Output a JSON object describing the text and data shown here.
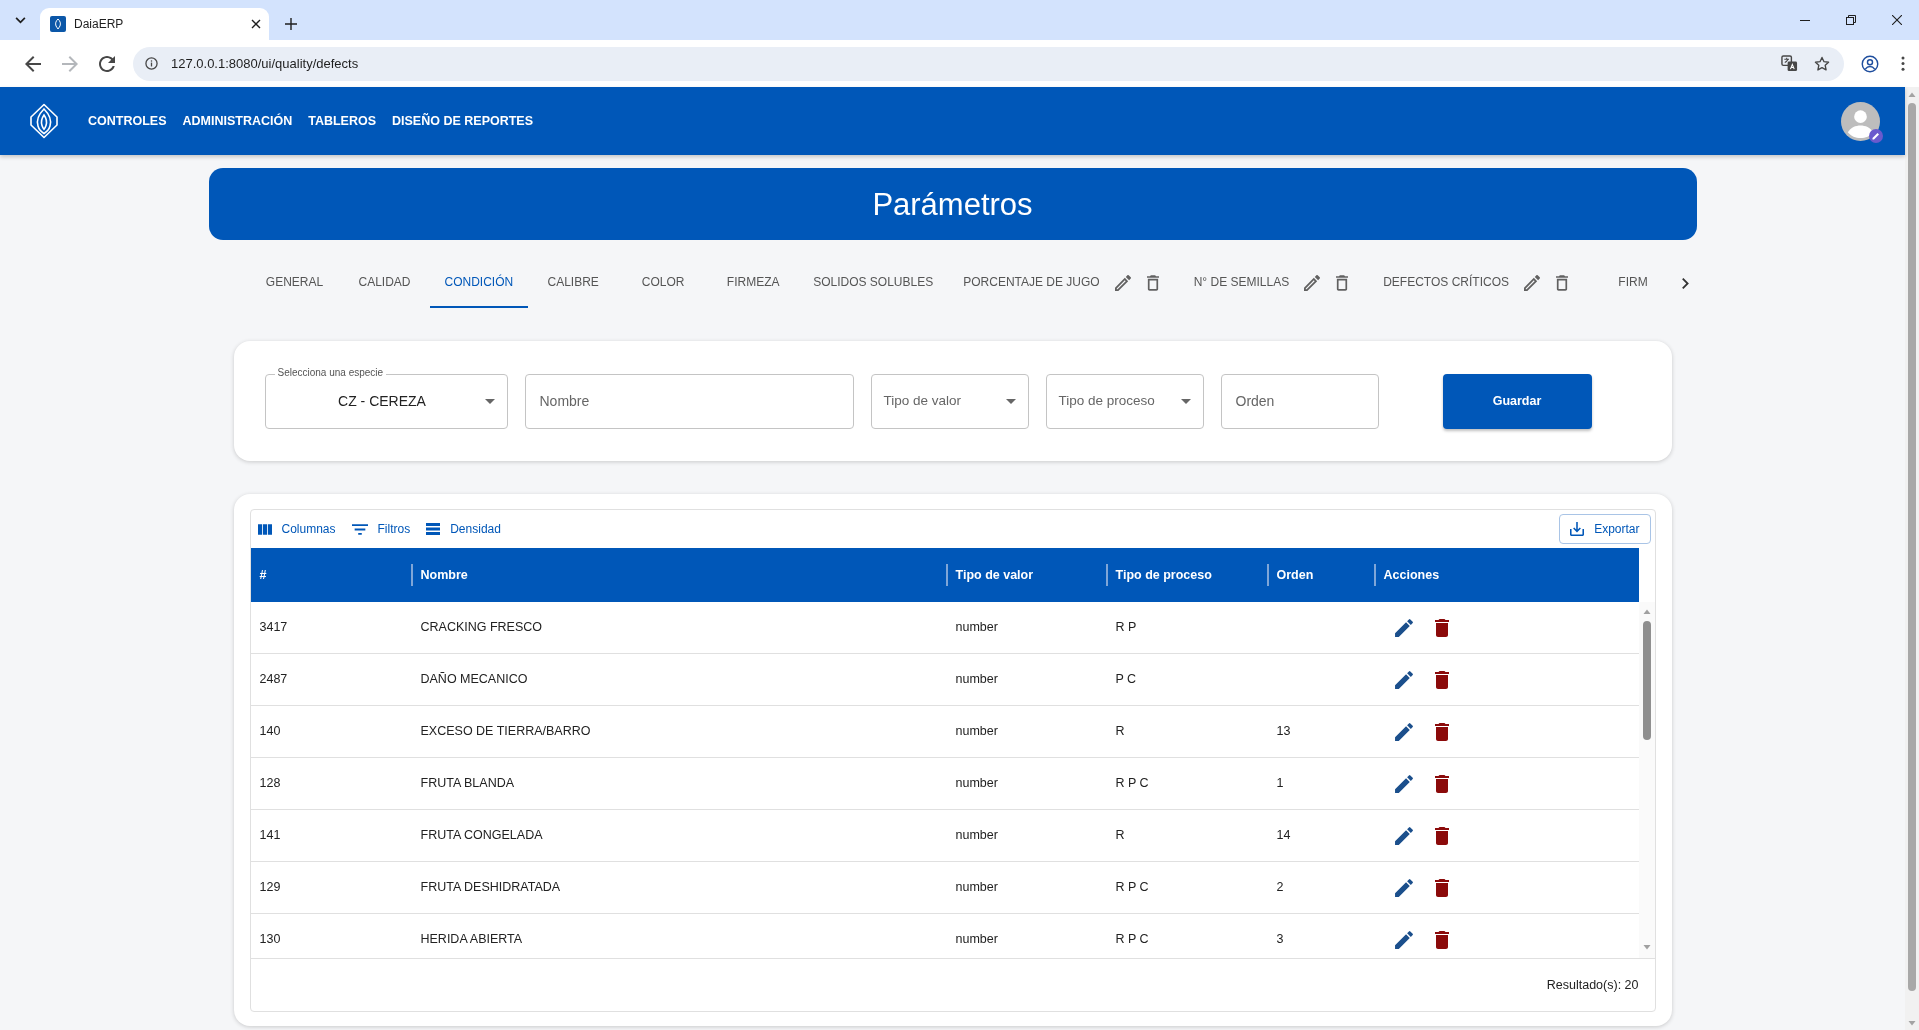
{
  "browser": {
    "tab_title": "DaiaERP",
    "url": "127.0.0.1:8080/ui/quality/defects",
    "nav_buttons": [
      {
        "kind": "back",
        "disabled": false
      },
      {
        "kind": "forward",
        "disabled": true
      },
      {
        "kind": "reload",
        "disabled": false
      }
    ]
  },
  "app_header": {
    "nav": [
      "CONTROLES",
      "ADMINISTRACIÓN",
      "TABLEROS",
      "DISEÑO DE REPORTES"
    ]
  },
  "page_title": "Parámetros",
  "tabs": [
    {
      "label": "GENERAL",
      "selected": false,
      "has_actions": false
    },
    {
      "label": "CALIDAD",
      "selected": false,
      "has_actions": false
    },
    {
      "label": "CONDICIÓN",
      "selected": true,
      "has_actions": false
    },
    {
      "label": "CALIBRE",
      "selected": false,
      "has_actions": false
    },
    {
      "label": "COLOR",
      "selected": false,
      "has_actions": false
    },
    {
      "label": "FIRMEZA",
      "selected": false,
      "has_actions": false
    },
    {
      "label": "SOLIDOS SOLUBLES",
      "selected": false,
      "has_actions": false
    },
    {
      "label": "PORCENTAJE DE JUGO",
      "selected": false,
      "has_actions": true
    },
    {
      "label": "N° DE SEMILLAS",
      "selected": false,
      "has_actions": true
    },
    {
      "label": "DEFECTOS CRÍTICOS",
      "selected": false,
      "has_actions": true
    },
    {
      "label": "FIRM",
      "selected": false,
      "has_actions": false
    }
  ],
  "form": {
    "species": {
      "label": "Selecciona una especie",
      "value": "CZ - CEREZA"
    },
    "fields": [
      {
        "kind": "text",
        "placeholder": "Nombre"
      },
      {
        "kind": "select",
        "placeholder": "Tipo de valor"
      },
      {
        "kind": "select",
        "placeholder": "Tipo de proceso"
      },
      {
        "kind": "text",
        "placeholder": "Orden"
      }
    ],
    "submit": "Guardar"
  },
  "table": {
    "toolbar": [
      {
        "kind": "columns",
        "label": "Columnas"
      },
      {
        "kind": "filters",
        "label": "Filtros"
      },
      {
        "kind": "density",
        "label": "Densidad"
      }
    ],
    "export": "Exportar",
    "columns": [
      "#",
      "Nombre",
      "Tipo de valor",
      "Tipo de proceso",
      "Orden",
      "Acciones"
    ],
    "rows": [
      {
        "number": "3417",
        "name": "CRACKING FRESCO",
        "value_type": "number",
        "process_type": "R P"
      },
      {
        "number": "2487",
        "name": "DAÑO MECANICO",
        "value_type": "number",
        "process_type": "P C"
      },
      {
        "number": "140",
        "name": "EXCESO DE TIERRA/BARRO",
        "value_type": "number",
        "process_type": "R",
        "order": "13"
      },
      {
        "number": "128",
        "name": "FRUTA BLANDA",
        "value_type": "number",
        "process_type": "R P C",
        "order": "1"
      },
      {
        "number": "141",
        "name": "FRUTA CONGELADA",
        "value_type": "number",
        "process_type": "R",
        "order": "14"
      },
      {
        "number": "129",
        "name": "FRUTA DESHIDRATADA",
        "value_type": "number",
        "process_type": "R P C",
        "order": "2"
      },
      {
        "number": "130",
        "name": "HERIDA ABIERTA",
        "value_type": "number",
        "process_type": "R P C",
        "order": "3"
      }
    ],
    "footer": "Resultado(s): 20"
  }
}
